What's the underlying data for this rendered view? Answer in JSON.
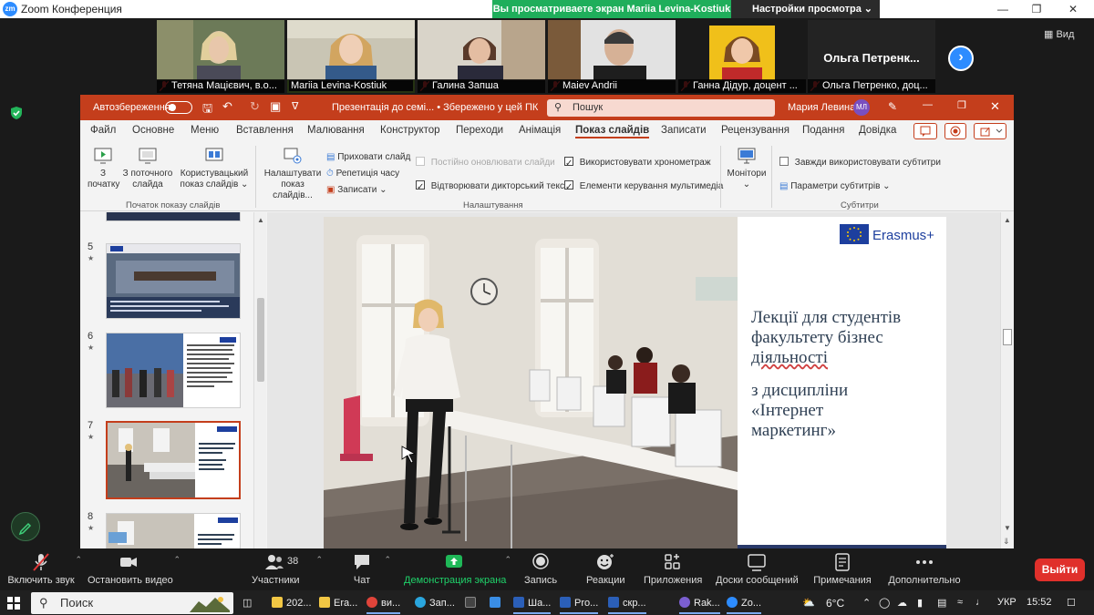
{
  "zoom": {
    "window_title": "Zoom Конференция",
    "share_banner": "Вы просматриваете экран Mariia Levina-Kostiuk",
    "view_options": "Настройки просмотра",
    "view_button": "Вид",
    "participants": [
      {
        "name": "Тетяна Мацієвич, в.о..."
      },
      {
        "name": "Mariia Levina-Kostiuk"
      },
      {
        "name": "Галина Запша"
      },
      {
        "name": "Maiev Andrii"
      },
      {
        "name": "Ганна Дідур, доцент ..."
      },
      {
        "name": "Ольга Петренко, доц..."
      }
    ],
    "name_only_tile": "Ольга  Петренк...",
    "controls": {
      "mute": "Включить звук",
      "video": "Остановить видео",
      "participants": "Участники",
      "participants_count": "38",
      "chat": "Чат",
      "share": "Демонстрация экрана",
      "record": "Запись",
      "reactions": "Реакции",
      "apps": "Приложения",
      "whiteboards": "Доски сообщений",
      "notes": "Примечания",
      "more": "Дополнительно",
      "leave": "Выйти"
    }
  },
  "ppt": {
    "autosave": "Автозбереження",
    "file_title": "Презентація до семі... • Збережено у цей ПК",
    "search_placeholder": "Пошук",
    "user_name": "Мария Левина",
    "user_initials": "МЛ",
    "tabs": [
      "Файл",
      "Основне",
      "Меню",
      "Вставлення",
      "Малювання",
      "Конструктор",
      "Переходи",
      "Анімація",
      "Показ слайдів",
      "Записати",
      "Рецензування",
      "Подання",
      "Довідка"
    ],
    "active_tab": "Показ слайдів",
    "ribbon": {
      "from_start": [
        "З",
        "початку"
      ],
      "from_current": [
        "З поточного",
        "слайда"
      ],
      "custom_show": [
        "Користувацький",
        "показ слайдів ⌄"
      ],
      "group_start": "Початок показу слайдів",
      "setup_show": [
        "Налаштувати",
        "показ слайдів..."
      ],
      "hide_slide": "Приховати слайд",
      "rehearse": "Репетиція часу",
      "record": "Записати ⌄",
      "keep_updated": "Постійно оновлювати слайди",
      "play_narrations": "Відтворювати дикторський текст",
      "use_timings": "Використовувати хронометраж",
      "media_controls": "Елементи керування мультимедіа",
      "group_setup": "Налаштування",
      "monitors": [
        "Монітори",
        "⌄"
      ],
      "always_subtitles": "Завжди використовувати субтитри",
      "subtitle_settings": "Параметри субтитрів ⌄",
      "group_subtitles": "Субтитри"
    },
    "thumbnails": [
      {
        "num": "5",
        "star": "★"
      },
      {
        "num": "6",
        "star": "★"
      },
      {
        "num": "7",
        "star": "★",
        "selected": true
      },
      {
        "num": "8",
        "star": "★"
      }
    ],
    "slide": {
      "logo_text": "Erasmus+",
      "lines_title": [
        "Лекції для студентів",
        "факультету бізнес",
        "діяльності"
      ],
      "lines_course": [
        "з дисципліни",
        "«Інтернет",
        "маркетинг»"
      ]
    }
  },
  "taskbar": {
    "search": "Поиск",
    "apps": [
      {
        "label": "202...",
        "color": "#f2c744"
      },
      {
        "label": "Era...",
        "color": "#f2c744"
      },
      {
        "label": "ви...",
        "color": "#e0443a"
      },
      {
        "label": "Зап...",
        "color": "#2aa6de"
      },
      {
        "label": "",
        "color": "#3a8ee6"
      },
      {
        "label": "Ша...",
        "color": "#2b5fb8"
      },
      {
        "label": "Pro...",
        "color": "#2b5fb8"
      },
      {
        "label": "скр...",
        "color": "#2b5fb8"
      },
      {
        "label": "Rak...",
        "color": "#7b5fd1"
      },
      {
        "label": "Zo...",
        "color": "#2D8CFF"
      }
    ],
    "weather": "6°C",
    "lang": "УКР",
    "time": "15:52"
  },
  "colors": {
    "ppt_accent": "#c43e1c",
    "zoom_blue": "#2D8CFF",
    "share_green": "#1fae5b",
    "leave_red": "#e0302b"
  }
}
